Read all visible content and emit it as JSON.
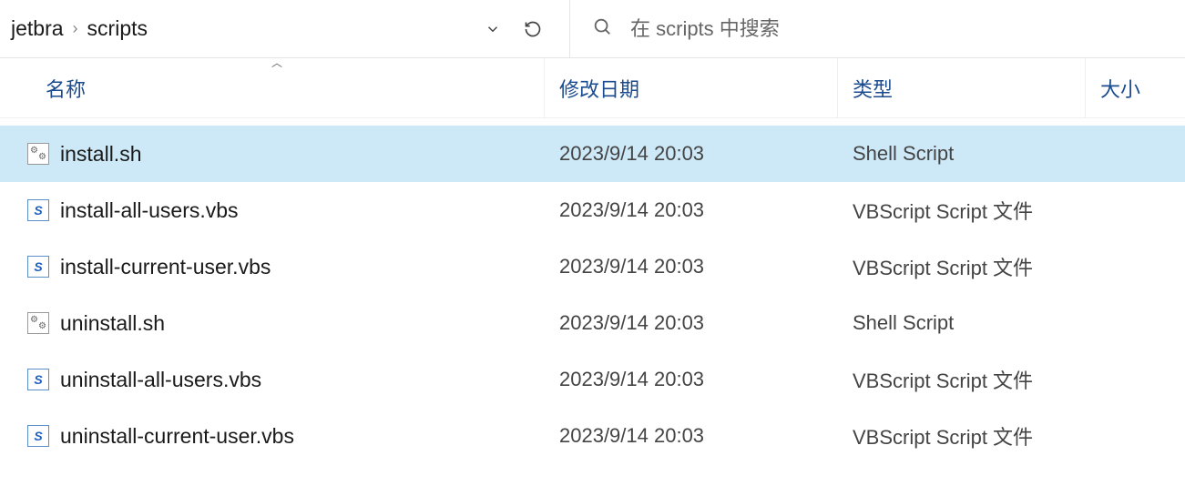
{
  "breadcrumb": {
    "parts": [
      "jetbra",
      "scripts"
    ]
  },
  "search": {
    "placeholder": "在 scripts 中搜索"
  },
  "columns": {
    "name": "名称",
    "date": "修改日期",
    "type": "类型",
    "size": "大小"
  },
  "files": [
    {
      "name": "install.sh",
      "date": "2023/9/14 20:03",
      "type": "Shell Script",
      "icon": "sh",
      "selected": true
    },
    {
      "name": "install-all-users.vbs",
      "date": "2023/9/14 20:03",
      "type": "VBScript Script 文件",
      "icon": "vbs",
      "selected": false
    },
    {
      "name": "install-current-user.vbs",
      "date": "2023/9/14 20:03",
      "type": "VBScript Script 文件",
      "icon": "vbs",
      "selected": false
    },
    {
      "name": "uninstall.sh",
      "date": "2023/9/14 20:03",
      "type": "Shell Script",
      "icon": "sh",
      "selected": false
    },
    {
      "name": "uninstall-all-users.vbs",
      "date": "2023/9/14 20:03",
      "type": "VBScript Script 文件",
      "icon": "vbs",
      "selected": false
    },
    {
      "name": "uninstall-current-user.vbs",
      "date": "2023/9/14 20:03",
      "type": "VBScript Script 文件",
      "icon": "vbs",
      "selected": false
    }
  ]
}
